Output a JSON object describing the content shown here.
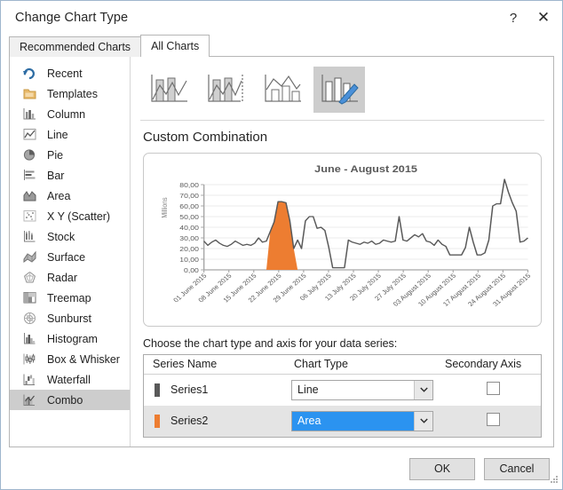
{
  "window": {
    "title": "Change Chart Type",
    "help_label": "?",
    "close_label": "✕"
  },
  "tabs": [
    {
      "label": "Recommended Charts",
      "active": false
    },
    {
      "label": "All Charts",
      "active": true
    }
  ],
  "sidebar": {
    "items": [
      {
        "label": "Recent",
        "icon": "recent-icon",
        "selected": false
      },
      {
        "label": "Templates",
        "icon": "templates-icon",
        "selected": false
      },
      {
        "label": "Column",
        "icon": "column-icon",
        "selected": false
      },
      {
        "label": "Line",
        "icon": "line-icon",
        "selected": false
      },
      {
        "label": "Pie",
        "icon": "pie-icon",
        "selected": false
      },
      {
        "label": "Bar",
        "icon": "bar-icon",
        "selected": false
      },
      {
        "label": "Area",
        "icon": "area-icon",
        "selected": false
      },
      {
        "label": "X Y (Scatter)",
        "icon": "scatter-icon",
        "selected": false
      },
      {
        "label": "Stock",
        "icon": "stock-icon",
        "selected": false
      },
      {
        "label": "Surface",
        "icon": "surface-icon",
        "selected": false
      },
      {
        "label": "Radar",
        "icon": "radar-icon",
        "selected": false
      },
      {
        "label": "Treemap",
        "icon": "treemap-icon",
        "selected": false
      },
      {
        "label": "Sunburst",
        "icon": "sunburst-icon",
        "selected": false
      },
      {
        "label": "Histogram",
        "icon": "histogram-icon",
        "selected": false
      },
      {
        "label": "Box & Whisker",
        "icon": "box-whisker-icon",
        "selected": false
      },
      {
        "label": "Waterfall",
        "icon": "waterfall-icon",
        "selected": false
      },
      {
        "label": "Combo",
        "icon": "combo-icon",
        "selected": true
      }
    ]
  },
  "thumbnails": [
    {
      "name": "clustered-column-line",
      "selected": false
    },
    {
      "name": "clustered-column-line-on-secondary-axis",
      "selected": false
    },
    {
      "name": "stacked-area-clustered-column",
      "selected": false
    },
    {
      "name": "custom-combination",
      "selected": true
    }
  ],
  "combo_heading": "Custom Combination",
  "series_section": {
    "instruction": "Choose the chart type and axis for your data series:",
    "columns": {
      "series_name": "Series Name",
      "chart_type": "Chart Type",
      "secondary_axis": "Secondary Axis"
    },
    "rows": [
      {
        "name": "Series1",
        "chart_type": "Line",
        "swatch": "#595959",
        "secondary_axis": false,
        "selected": false,
        "highlighted_value": false
      },
      {
        "name": "Series2",
        "chart_type": "Area",
        "swatch": "#ED7D31",
        "secondary_axis": false,
        "selected": true,
        "highlighted_value": true
      }
    ]
  },
  "footer": {
    "ok_label": "OK",
    "cancel_label": "Cancel"
  },
  "colors": {
    "accent_blue": "#2b93f0",
    "series1": "#595959",
    "series2": "#ED7D31",
    "selection_gray": "#cdcdcd"
  },
  "chart_data": {
    "type": "line",
    "title": "June - August 2015",
    "xlabel": "",
    "ylabel": "Millions",
    "ylim": [
      0,
      80
    ],
    "yticks": [
      "0,00",
      "10,00",
      "20,00",
      "30,00",
      "40,00",
      "50,00",
      "60,00",
      "70,00",
      "80,00"
    ],
    "grid": true,
    "legend": "none",
    "x_tick_labels": [
      "01 June 2015",
      "08 June 2015",
      "15 June 2015",
      "22 June 2015",
      "29 June 2015",
      "06 July 2015",
      "13 July 2015",
      "20 July 2015",
      "27 July 2015",
      "03 August 2015",
      "10 August 2015",
      "17 August 2015",
      "24 August 2015",
      "31 August 2015"
    ],
    "series": [
      {
        "name": "Series1",
        "type": "line",
        "color": "#595959",
        "values": [
          27,
          23,
          26,
          28,
          25,
          23,
          22,
          24,
          27,
          25,
          23,
          24,
          23,
          25,
          30,
          26,
          27,
          36,
          45,
          64,
          64,
          63,
          46,
          20,
          28,
          20,
          46,
          50,
          50,
          39,
          40,
          37,
          21,
          2,
          2,
          2,
          2,
          28,
          26,
          25,
          24,
          26,
          25,
          27,
          24,
          25,
          28,
          27,
          26,
          27,
          50,
          28,
          27,
          30,
          33,
          31,
          34,
          27,
          26,
          23,
          28,
          24,
          22,
          14,
          14,
          14,
          14,
          21,
          40,
          26,
          14,
          14,
          16,
          28,
          60,
          62,
          62,
          85,
          73,
          63,
          55,
          26,
          27,
          30
        ]
      },
      {
        "name": "Series2",
        "type": "area",
        "color": "#ED7D31",
        "values": [
          0,
          0,
          0,
          0,
          0,
          0,
          0,
          0,
          0,
          0,
          0,
          0,
          0,
          0,
          0,
          0,
          0,
          36,
          45,
          64,
          64,
          63,
          46,
          20,
          0,
          0,
          0,
          0,
          0,
          0,
          0,
          0,
          0,
          0,
          0,
          0,
          0,
          0,
          0,
          0,
          0,
          0,
          0,
          0,
          0,
          0,
          0,
          0,
          0,
          0,
          0,
          0,
          0,
          0,
          0,
          0,
          0,
          0,
          0,
          0,
          0,
          0,
          0,
          0,
          0,
          0,
          0,
          0,
          0,
          0,
          0,
          0,
          0,
          0,
          0,
          0,
          0,
          0,
          0,
          0,
          0,
          0,
          0,
          0
        ]
      }
    ]
  }
}
